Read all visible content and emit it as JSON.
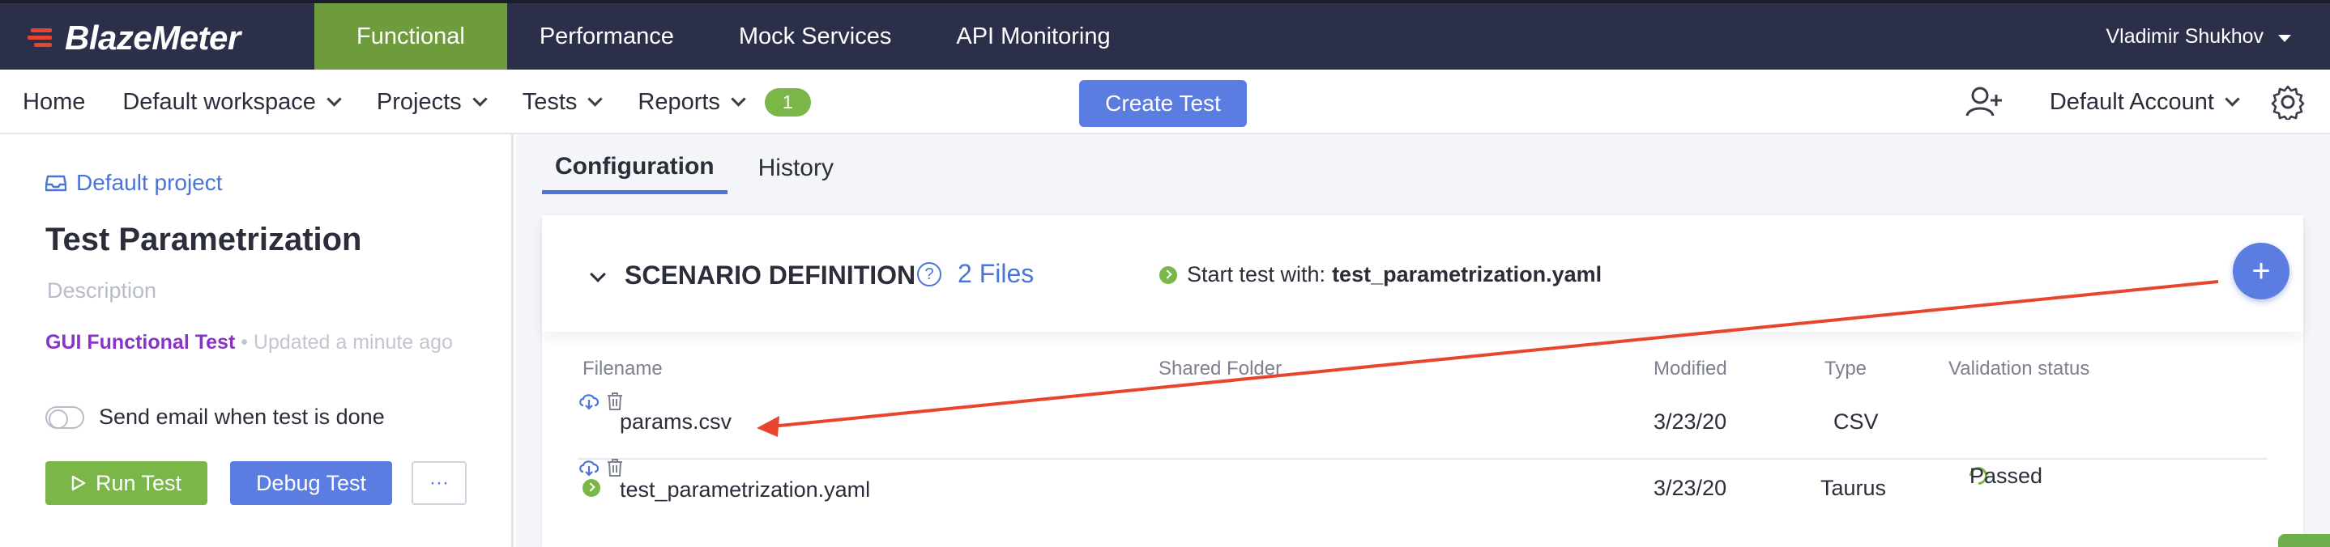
{
  "brand": {
    "logo_text": "BlazeMeter",
    "accent": "#e8452c"
  },
  "topnav": {
    "items": [
      {
        "label": "Functional",
        "active": true
      },
      {
        "label": "Performance"
      },
      {
        "label": "Mock Services"
      },
      {
        "label": "API Monitoring"
      }
    ],
    "user": "Vladimir Shukhov"
  },
  "subnav": {
    "home": "Home",
    "workspace": "Default workspace",
    "projects": "Projects",
    "tests": "Tests",
    "reports": "Reports",
    "reports_badge": "1",
    "create_test": "Create Test",
    "account": "Default Account"
  },
  "left": {
    "project": "Default project",
    "title": "Test Parametrization",
    "description_placeholder": "Description",
    "test_kind": "GUI Functional Test",
    "updated": "Updated a minute ago",
    "email_toggle_label": "Send email when test is done",
    "email_toggle_on": false,
    "run_label": "Run Test",
    "debug_label": "Debug Test",
    "more_label": "···"
  },
  "tabs": [
    {
      "label": "Configuration",
      "active": true
    },
    {
      "label": "History"
    }
  ],
  "scenario": {
    "title": "SCENARIO DEFINITION",
    "help": "?",
    "files_count": "2 Files",
    "start_prefix": "Start test with:",
    "start_file": "test_parametrization.yaml",
    "add": "+"
  },
  "table": {
    "headers": {
      "filename": "Filename",
      "shared": "Shared Folder",
      "modified": "Modified",
      "type": "Type",
      "validation": "Validation status"
    },
    "rows": [
      {
        "filename": "params.csv",
        "modified": "3/23/20",
        "type": "CSV",
        "status": "",
        "is_start": false
      },
      {
        "filename": "test_parametrization.yaml",
        "modified": "3/23/20",
        "type": "Taurus",
        "status": "Passed",
        "is_start": true
      }
    ]
  },
  "colors": {
    "topbar": "#2c2f4a",
    "functional_green": "#6e9c3c",
    "primary_blue": "#5b7ce0",
    "success_green": "#7ab648",
    "annotation_red": "#e8452c"
  }
}
